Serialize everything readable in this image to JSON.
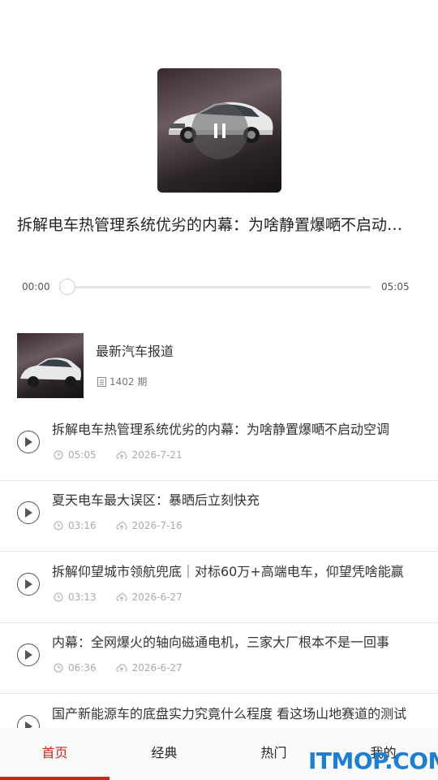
{
  "player": {
    "track_title": "拆解电车热管理系统优劣的内幕：为啥静置爆嗮不启动空调",
    "current_time": "00:00",
    "duration": "05:05",
    "progress": 0
  },
  "album": {
    "name": "最新汽车报道",
    "episode_count": "1402 期"
  },
  "episodes": [
    {
      "title": "拆解电车热管理系统优劣的内幕：为啥静置爆嗮不启动空调",
      "duration": "05:05",
      "date": "2026-7-21"
    },
    {
      "title": "夏天电车最大误区：暴晒后立刻快充",
      "duration": "03:16",
      "date": "2026-7-16"
    },
    {
      "title": "拆解仰望城市领航兜底｜对标60万+高端电车，仰望凭啥能赢",
      "duration": "03:13",
      "date": "2026-6-27"
    },
    {
      "title": "内幕：全网爆火的轴向磁通电机，三家大厂根本不是一回事",
      "duration": "06:36",
      "date": "2026-6-27"
    },
    {
      "title": "国产新能源车的底盘实力究竟什么程度 看这场山地赛道的测试",
      "duration": "",
      "date": ""
    }
  ],
  "tabs": [
    {
      "label": "首页"
    },
    {
      "label": "经典"
    },
    {
      "label": "热门"
    },
    {
      "label": "我的"
    }
  ],
  "watermark": "ITMOP.COM",
  "colors": {
    "accent": "#d1221d",
    "watermark": "#1c7fd6"
  },
  "icons": {
    "pause": "pause-icon",
    "play": "play-icon",
    "clock": "clock-icon",
    "upload": "upload-icon",
    "list": "list-icon"
  }
}
